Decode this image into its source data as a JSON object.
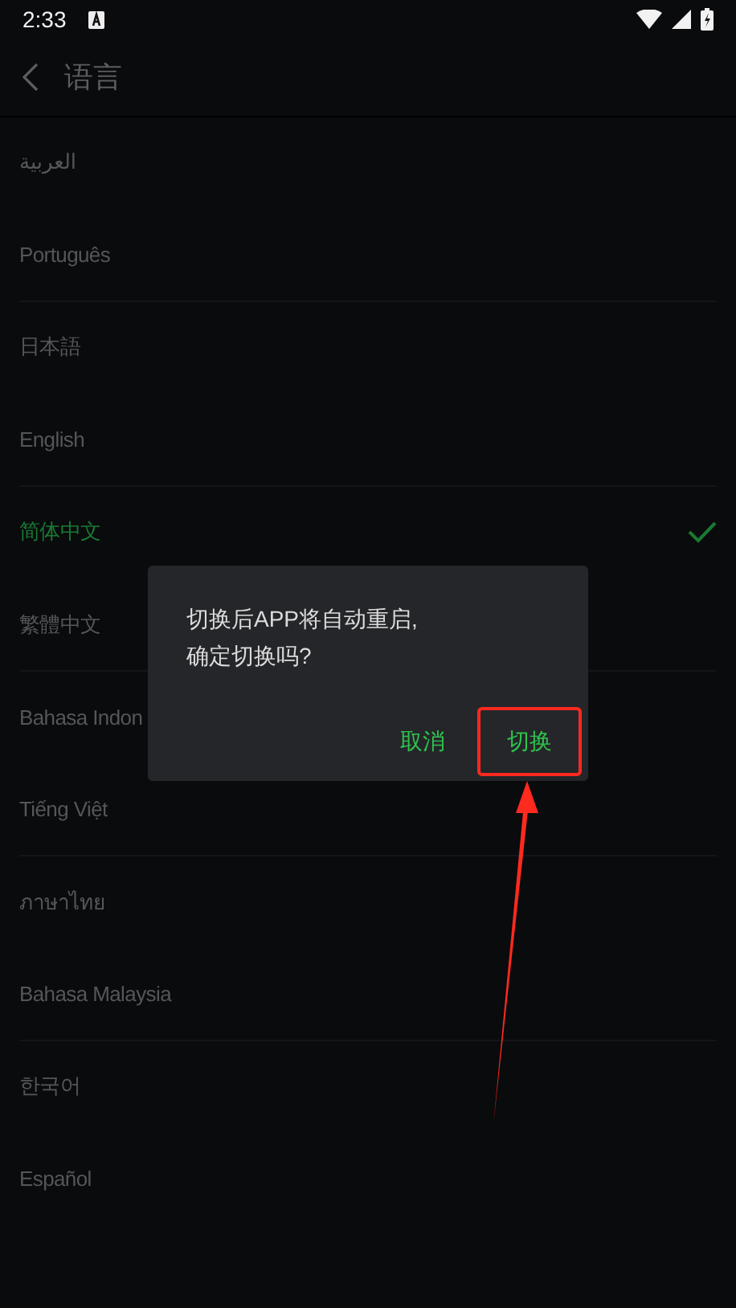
{
  "status_bar": {
    "time": "2:33"
  },
  "header": {
    "title": "语言"
  },
  "languages": [
    {
      "label": "العربية",
      "selected": false
    },
    {
      "label": "Português",
      "selected": false
    },
    {
      "label": "日本語",
      "selected": false
    },
    {
      "label": "English",
      "selected": false
    },
    {
      "label": "简体中文",
      "selected": true
    },
    {
      "label": "繁體中文",
      "selected": false
    },
    {
      "label": "Bahasa Indon",
      "selected": false
    },
    {
      "label": "Tiếng Việt",
      "selected": false
    },
    {
      "label": "ภาษาไทย",
      "selected": false
    },
    {
      "label": "Bahasa Malaysia",
      "selected": false
    },
    {
      "label": "한국어",
      "selected": false
    },
    {
      "label": "Español",
      "selected": false
    }
  ],
  "dialog": {
    "message_lines": [
      "切换后APP将自动重启,",
      "确定切换吗?"
    ],
    "buttons": [
      {
        "label": "取消",
        "highlighted": false
      },
      {
        "label": "切换",
        "highlighted": true
      }
    ]
  }
}
